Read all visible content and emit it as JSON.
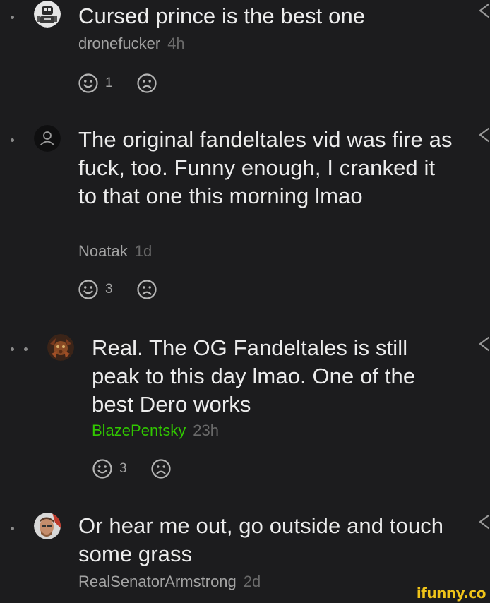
{
  "comments": [
    {
      "depth": 1,
      "text": "Cursed prince is the best one",
      "author": "dronefucker",
      "time": "4h",
      "likes": "1",
      "author_color": "#a3a3a3",
      "avatar": "robot-avatar"
    },
    {
      "depth": 1,
      "text": "The original fandeltales vid was fire as fuck, too. Funny enough, I cranked it to that one this morning lmao",
      "author": "Noatak",
      "time": "1d",
      "likes": "3",
      "author_color": "#a3a3a3",
      "avatar": "default-user-avatar"
    },
    {
      "depth": 2,
      "text": "Real. The OG Fandeltales is still peak to this day lmao. One of the best Dero works",
      "author": "BlazePentsky",
      "time": "23h",
      "likes": "3",
      "author_color": "#31c800",
      "avatar": "character-avatar"
    },
    {
      "depth": 1,
      "text": "Or hear me out, go outside and touch some grass",
      "author": "RealSenatorArmstrong",
      "time": "2d",
      "likes": "",
      "author_color": "#a3a3a3",
      "avatar": "photo-avatar"
    }
  ],
  "watermark": "ifunny.co",
  "colors": {
    "background": "#1c1c1e",
    "text": "#ececec",
    "muted": "#a3a3a3",
    "time": "#6a6a6a",
    "highlight_author": "#31c800",
    "watermark": "#f0c419"
  }
}
